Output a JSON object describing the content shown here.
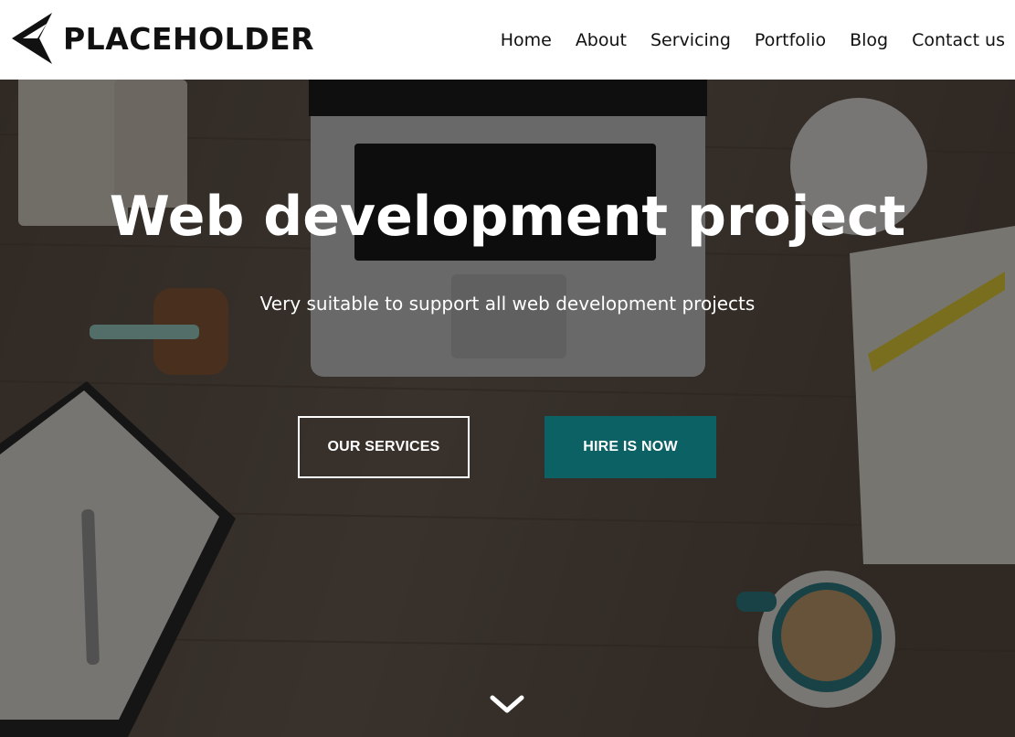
{
  "brand": {
    "name": "PLACEHOLDER",
    "logo_icon": "arrowhead-logo-icon"
  },
  "nav": {
    "items": [
      {
        "label": "Home"
      },
      {
        "label": "About"
      },
      {
        "label": "Servicing"
      },
      {
        "label": "Portfolio"
      },
      {
        "label": "Blog"
      },
      {
        "label": "Contact us"
      }
    ]
  },
  "hero": {
    "title": "Web development project",
    "subtitle": "Very suitable to support all web development projects",
    "primary_button": "OUR SERVICES",
    "secondary_button": "HIRE IS NOW",
    "scroll_icon": "chevron-down-icon"
  },
  "colors": {
    "accent": "#0b6164",
    "nav_bg": "#ffffff",
    "text_dark": "#111111"
  }
}
